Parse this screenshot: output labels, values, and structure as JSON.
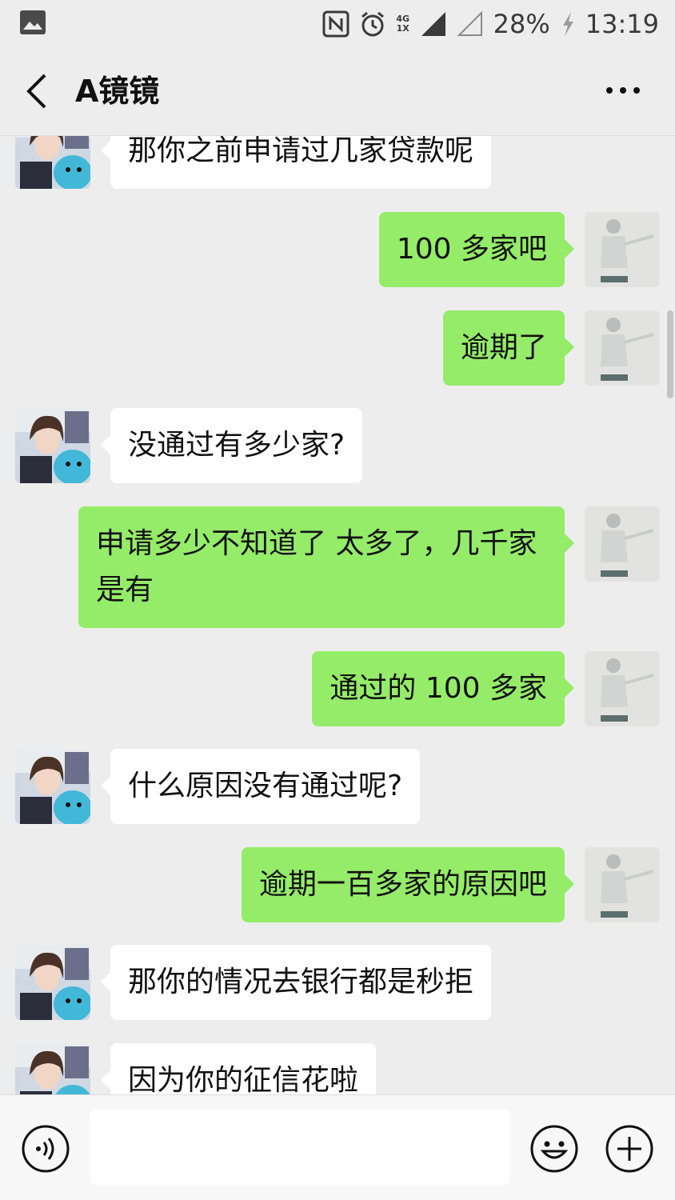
{
  "status_bar": {
    "network_top": "4G",
    "network_bottom": "1X",
    "battery": "28%",
    "time": "13:19",
    "icons": [
      "gallery-icon",
      "nfc-icon",
      "alarm-icon",
      "signal-icon",
      "battery-charging-icon"
    ]
  },
  "header": {
    "title": "A镜镜",
    "back_icon": "chevron-left-icon",
    "more_icon": "more-dots-icon"
  },
  "messages": [
    {
      "side": "left",
      "text": "那你之前申请过几家贷款呢"
    },
    {
      "side": "right",
      "text": "100 多家吧"
    },
    {
      "side": "right",
      "text": "逾期了"
    },
    {
      "side": "left",
      "text": "没通过有多少家?"
    },
    {
      "side": "right",
      "text": "申请多少不知道了 太多了，几千家是有"
    },
    {
      "side": "right",
      "text": "通过的 100 多家"
    },
    {
      "side": "left",
      "text": "什么原因没有通过呢?"
    },
    {
      "side": "right",
      "text": "逾期一百多家的原因吧"
    },
    {
      "side": "left",
      "text": "那你的情况去银行都是秒拒"
    },
    {
      "side": "left",
      "text": "因为你的征信花啦"
    }
  ],
  "input_bar": {
    "placeholder": "",
    "icons": [
      "voice-icon",
      "emoji-icon",
      "plus-icon"
    ]
  },
  "colors": {
    "background": "#ededed",
    "bubble_self": "#95ec69",
    "bubble_other": "#ffffff"
  }
}
